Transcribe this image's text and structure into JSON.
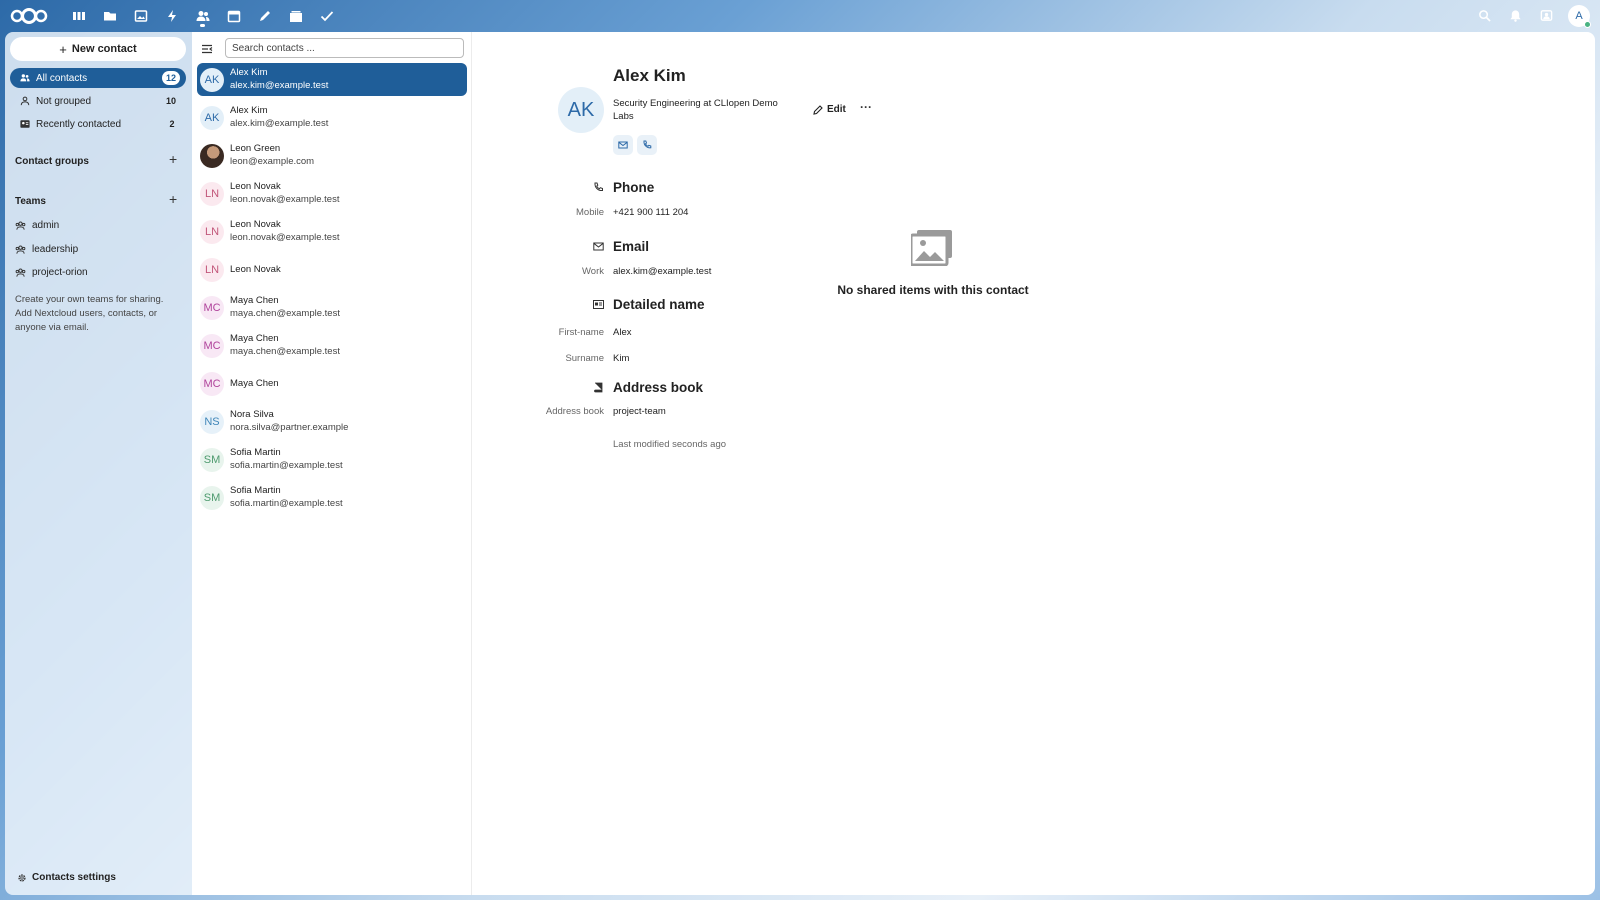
{
  "header": {
    "apps": [
      "dashboard-icon",
      "files-icon",
      "photos-icon",
      "activity-icon",
      "contacts-icon",
      "calendar-icon",
      "notes-icon",
      "deck-icon",
      "tasks-icon"
    ],
    "active_app": "contacts-icon",
    "user_initial": "A"
  },
  "nav": {
    "new_contact": "New contact",
    "items": [
      {
        "label": "All contacts",
        "count": "12"
      },
      {
        "label": "Not grouped",
        "count": "10"
      },
      {
        "label": "Recently contacted",
        "count": "2"
      }
    ],
    "contact_groups": "Contact groups",
    "teams": "Teams",
    "team_items": [
      "admin",
      "leadership",
      "project-orion"
    ],
    "teams_hint": "Create your own teams for sharing. Add Nextcloud users, contacts, or anyone via email.",
    "settings": "Contacts settings"
  },
  "list": {
    "search_placeholder": "Search contacts ...",
    "contacts": [
      {
        "initials": "AK",
        "name": "Alex Kim",
        "email": "alex.kim@example.test",
        "color": "#2d6aa8",
        "bg": "#e3eff8"
      },
      {
        "initials": "AK",
        "name": "Alex Kim",
        "email": "alex.kim@example.test",
        "color": "#2d6aa8",
        "bg": "#e3eff8"
      },
      {
        "initials": "",
        "name": "Leon Green",
        "email": "leon@example.com",
        "color": "#222",
        "bg": "#444"
      },
      {
        "initials": "LN",
        "name": "Leon Novak",
        "email": "leon.novak@example.test",
        "color": "#c2577a",
        "bg": "#fbe9ef"
      },
      {
        "initials": "LN",
        "name": "Leon Novak",
        "email": "leon.novak@example.test",
        "color": "#c2577a",
        "bg": "#fbe9ef"
      },
      {
        "initials": "LN",
        "name": "Leon Novak",
        "email": "",
        "color": "#c2577a",
        "bg": "#fbe9ef"
      },
      {
        "initials": "MC",
        "name": "Maya Chen",
        "email": "maya.chen@example.test",
        "color": "#b0439b",
        "bg": "#f8e8f5"
      },
      {
        "initials": "MC",
        "name": "Maya Chen",
        "email": "maya.chen@example.test",
        "color": "#b0439b",
        "bg": "#f8e8f5"
      },
      {
        "initials": "MC",
        "name": "Maya Chen",
        "email": "",
        "color": "#b0439b",
        "bg": "#f8e8f5"
      },
      {
        "initials": "NS",
        "name": "Nora Silva",
        "email": "nora.silva@partner.example",
        "color": "#3f86b8",
        "bg": "#e6f1f9"
      },
      {
        "initials": "SM",
        "name": "Sofia Martin",
        "email": "sofia.martin@example.test",
        "color": "#4d9a6e",
        "bg": "#e8f4ed"
      },
      {
        "initials": "SM",
        "name": "Sofia Martin",
        "email": "sofia.martin@example.test",
        "color": "#4d9a6e",
        "bg": "#e8f4ed"
      }
    ]
  },
  "details": {
    "initials": "AK",
    "name": "Alex Kim",
    "org": "Security Engineering at CLIopen Demo Labs",
    "edit": "Edit",
    "more": "···",
    "phone_title": "Phone",
    "phone_label": "Mobile",
    "phone_value": "+421 900 111 204",
    "email_title": "Email",
    "email_label": "Work",
    "email_value": "alex.kim@example.test",
    "name_title": "Detailed name",
    "first_label": "First-name",
    "first_value": "Alex",
    "surname_label": "Surname",
    "surname_value": "Kim",
    "book_title": "Address book",
    "book_label": "Address book",
    "book_value": "project-team",
    "last_modified": "Last modified seconds ago",
    "empty_text": "No shared items with this contact"
  },
  "colors": {
    "primary": "#1f5e99",
    "header": "#2d6aa8"
  }
}
